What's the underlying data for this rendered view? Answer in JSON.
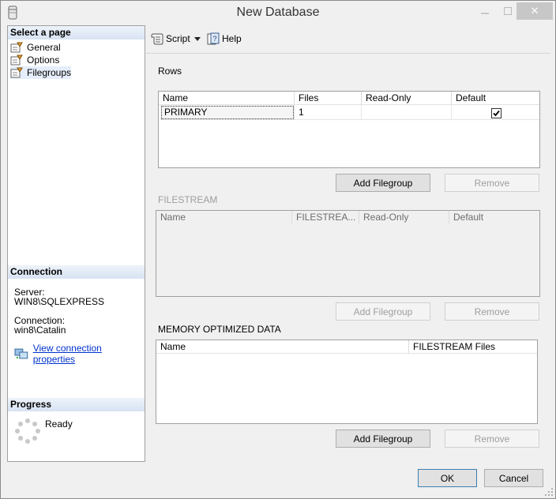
{
  "window": {
    "title": "New Database",
    "icon": "database-icon",
    "close_glyph": "✕"
  },
  "left_pane": {
    "select_page_header": "Select a page",
    "pages": [
      {
        "label": "General",
        "icon": "page-wrench-icon"
      },
      {
        "label": "Options",
        "icon": "page-wrench-icon"
      },
      {
        "label": "Filegroups",
        "icon": "page-wrench-icon",
        "selected": true
      }
    ],
    "connection_header": "Connection",
    "server_label": "Server:",
    "server_value": "WIN8\\SQLEXPRESS",
    "connection_label": "Connection:",
    "connection_value": "win8\\Catalin",
    "view_connection_link": "View connection properties",
    "progress_header": "Progress",
    "progress_status": "Ready"
  },
  "toolbar": {
    "script_label": "Script",
    "help_label": "Help"
  },
  "rows_section": {
    "label": "Rows",
    "columns": [
      "Name",
      "Files",
      "Read-Only",
      "Default"
    ],
    "rows": [
      {
        "name": "PRIMARY",
        "files": "1",
        "read_only": false,
        "default": true
      }
    ],
    "add_button": "Add Filegroup",
    "remove_button": "Remove"
  },
  "filestream_section": {
    "label": "FILESTREAM",
    "columns": [
      "Name",
      "FILESTREA...",
      "Read-Only",
      "Default"
    ],
    "add_button": "Add Filegroup",
    "remove_button": "Remove"
  },
  "memory_section": {
    "label": "MEMORY OPTIMIZED DATA",
    "columns": [
      "Name",
      "FILESTREAM Files"
    ],
    "add_button": "Add Filegroup",
    "remove_button": "Remove"
  },
  "footer": {
    "ok_button": "OK",
    "cancel_button": "Cancel"
  }
}
